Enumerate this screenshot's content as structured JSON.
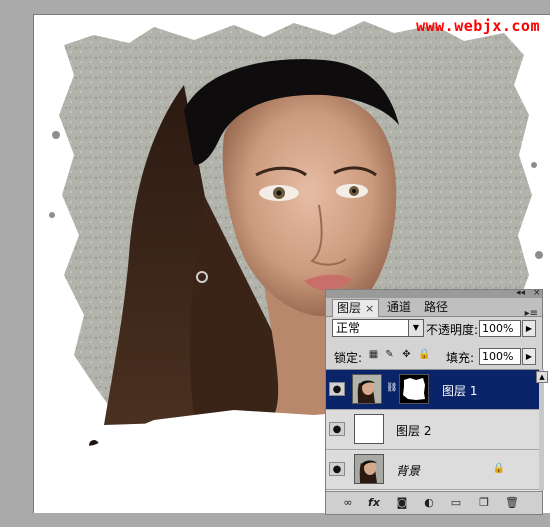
{
  "watermark": "www.webjx.com",
  "layers_panel": {
    "tabs": [
      {
        "label": "图层",
        "active": true,
        "close": "×"
      },
      {
        "label": "通道",
        "active": false
      },
      {
        "label": "路径",
        "active": false
      }
    ],
    "menu_icon": "panel-menu-icon",
    "blend_mode": "正常",
    "opacity_label": "不透明度:",
    "opacity_value": "100%",
    "lock_label": "锁定:",
    "fill_label": "填充:",
    "fill_value": "100%",
    "layers": [
      {
        "name": "图层 1",
        "selected": true,
        "has_mask": true,
        "thumbnail": "portrait"
      },
      {
        "name": "图层 2",
        "selected": false,
        "has_mask": false,
        "thumbnail": "white"
      },
      {
        "name": "背景",
        "selected": false,
        "has_mask": false,
        "thumbnail": "portrait",
        "locked": true,
        "italic": true
      }
    ],
    "footer_icons": [
      "link-layers-icon",
      "fx-icon",
      "add-mask-icon",
      "adjustment-layer-icon",
      "new-group-icon",
      "new-layer-icon",
      "delete-layer-icon"
    ]
  },
  "colors": {
    "selected_row": "#0a246a",
    "watermark": "#ff0000"
  }
}
